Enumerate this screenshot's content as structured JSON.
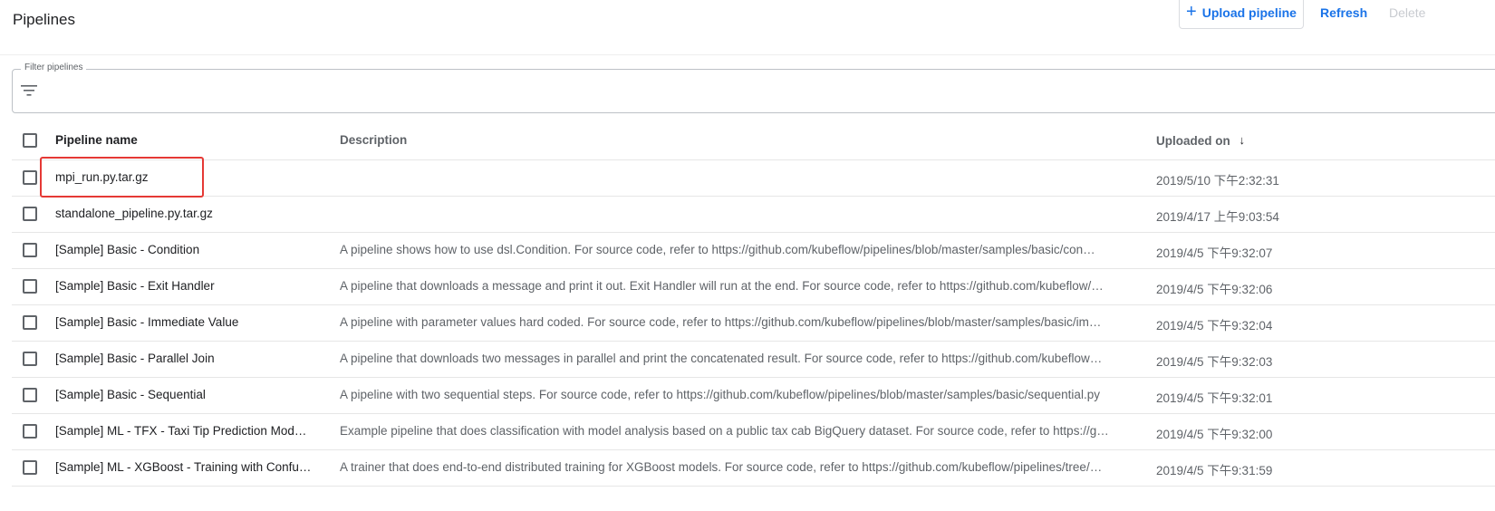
{
  "page": {
    "title": "Pipelines"
  },
  "toolbar": {
    "upload_icon": "plus-icon",
    "upload_label": "Upload pipeline",
    "refresh_label": "Refresh",
    "delete_label": "Delete"
  },
  "filter": {
    "label": "Filter pipelines",
    "icon": "filter-list-icon"
  },
  "table": {
    "columns": {
      "name": "Pipeline name",
      "description": "Description",
      "uploaded": "Uploaded on",
      "sort_icon": "arrow-down-icon"
    },
    "rows": [
      {
        "name": "mpi_run.py.tar.gz",
        "description": "",
        "uploaded": "2019/5/10 下午2:32:31"
      },
      {
        "name": "standalone_pipeline.py.tar.gz",
        "description": "",
        "uploaded": "2019/4/17 上午9:03:54"
      },
      {
        "name": "[Sample] Basic - Condition",
        "description": "A pipeline shows how to use dsl.Condition. For source code, refer to https://github.com/kubeflow/pipelines/blob/master/samples/basic/con…",
        "uploaded": "2019/4/5 下午9:32:07"
      },
      {
        "name": "[Sample] Basic - Exit Handler",
        "description": "A pipeline that downloads a message and print it out. Exit Handler will run at the end. For source code, refer to https://github.com/kubeflow/…",
        "uploaded": "2019/4/5 下午9:32:06"
      },
      {
        "name": "[Sample] Basic - Immediate Value",
        "description": "A pipeline with parameter values hard coded. For source code, refer to https://github.com/kubeflow/pipelines/blob/master/samples/basic/im…",
        "uploaded": "2019/4/5 下午9:32:04"
      },
      {
        "name": "[Sample] Basic - Parallel Join",
        "description": "A pipeline that downloads two messages in parallel and print the concatenated result. For source code, refer to https://github.com/kubeflow…",
        "uploaded": "2019/4/5 下午9:32:03"
      },
      {
        "name": "[Sample] Basic - Sequential",
        "description": "A pipeline with two sequential steps. For source code, refer to https://github.com/kubeflow/pipelines/blob/master/samples/basic/sequential.py",
        "uploaded": "2019/4/5 下午9:32:01"
      },
      {
        "name": "[Sample] ML - TFX - Taxi Tip Prediction Mod…",
        "description": "Example pipeline that does classification with model analysis based on a public tax cab BigQuery dataset. For source code, refer to https://g…",
        "uploaded": "2019/4/5 下午9:32:00"
      },
      {
        "name": "[Sample] ML - XGBoost - Training with Confu…",
        "description": "A trainer that does end-to-end distributed training for XGBoost models. For source code, refer to https://github.com/kubeflow/pipelines/tree/…",
        "uploaded": "2019/4/5 下午9:31:59"
      }
    ]
  }
}
